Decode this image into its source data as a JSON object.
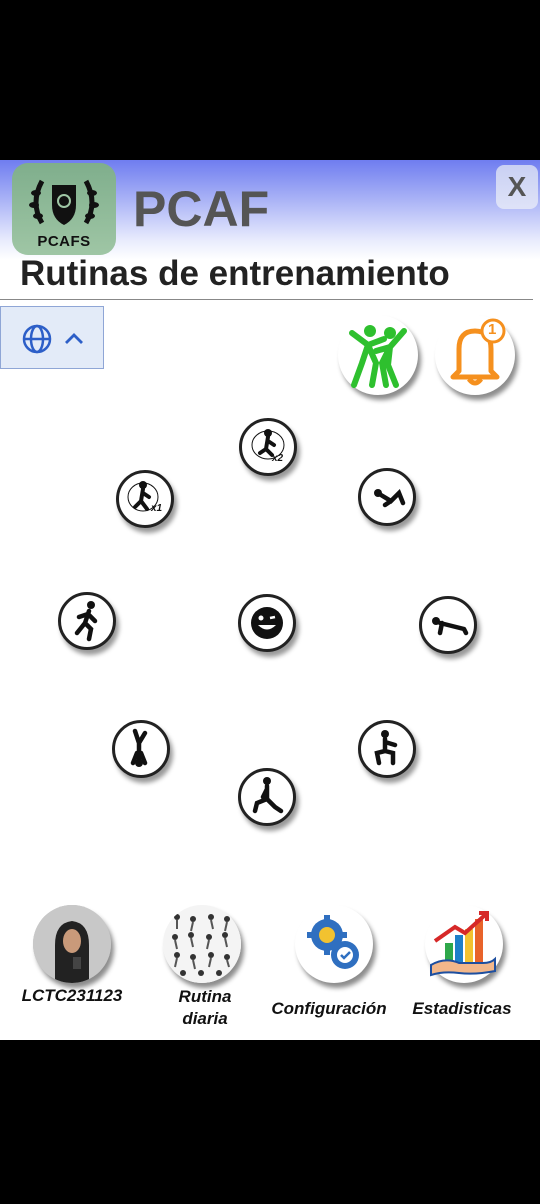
{
  "app": {
    "name": "PCAF",
    "logo_text": "PCAFS",
    "close_label": "X"
  },
  "page": {
    "title": "Rutinas de entrenamiento"
  },
  "language": {
    "icon": "globe-icon",
    "chevron": "chevron-up-icon"
  },
  "top_actions": [
    {
      "icon": "dancers-icon"
    },
    {
      "icon": "bell-icon",
      "badge": "1"
    }
  ],
  "exercises": [
    {
      "icon": "jump-x2-icon",
      "badge": "x2"
    },
    {
      "icon": "jump-x1-icon",
      "badge": "x1"
    },
    {
      "icon": "situp-icon"
    },
    {
      "icon": "run-icon"
    },
    {
      "icon": "smiley-icon"
    },
    {
      "icon": "pushup-icon"
    },
    {
      "icon": "handstand-icon"
    },
    {
      "icon": "squat-icon"
    },
    {
      "icon": "lunge-icon"
    }
  ],
  "bottom_nav": [
    {
      "label": "LCTC231123",
      "icon": "avatar"
    },
    {
      "label": "Rutina diaria",
      "line1": "Rutina",
      "line2": "diaria",
      "icon": "routine-collage-icon"
    },
    {
      "label": "Configuración",
      "icon": "gears-icon"
    },
    {
      "label": "Estadisticas",
      "icon": "stats-chart-icon"
    }
  ],
  "colors": {
    "header_top": "#6f7df0",
    "logo_bg": "#8fb89a",
    "accent_green": "#2ec02e",
    "bell_orange": "#f5901e",
    "gear_blue": "#2f6fc0"
  }
}
